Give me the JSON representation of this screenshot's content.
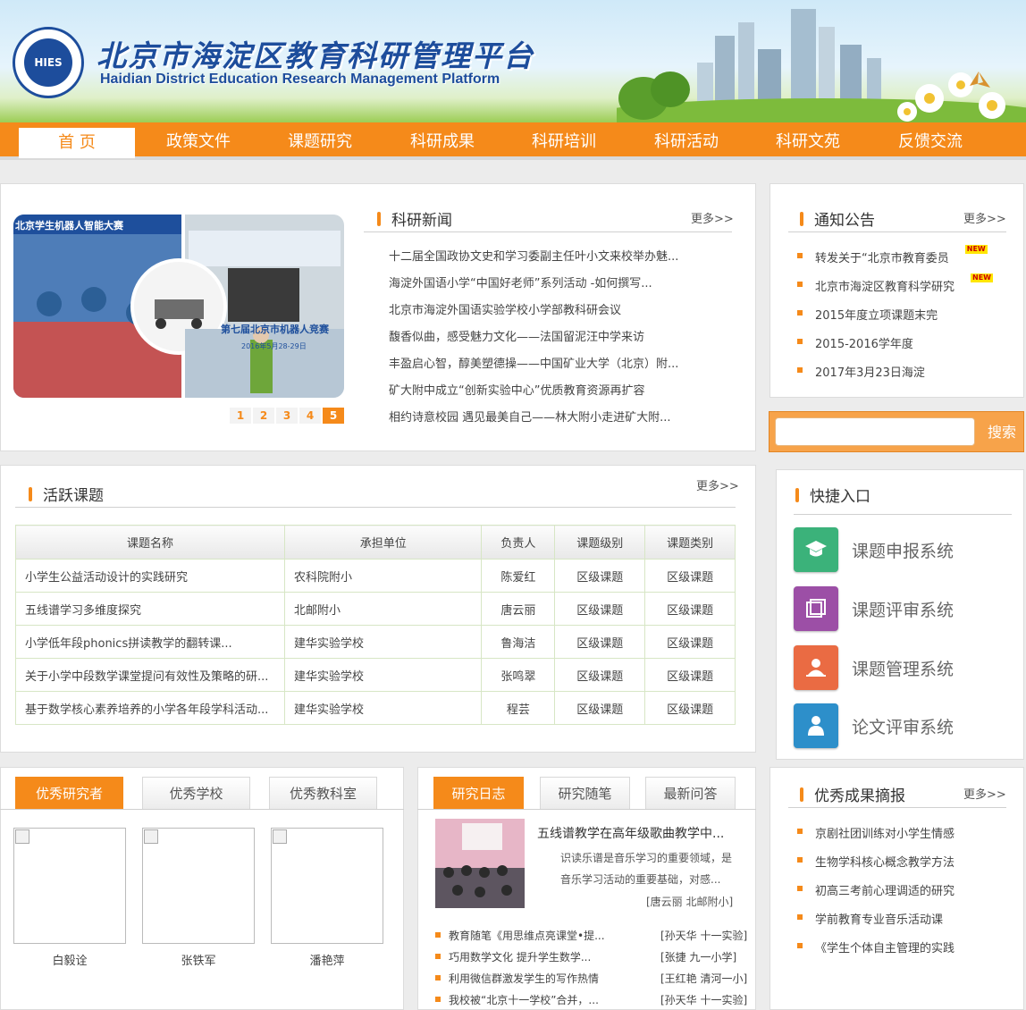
{
  "header": {
    "logo_text": "HIES",
    "title_cn": "北京市海淀区教育科研管理平台",
    "title_en": "Haidian District Education Research Management Platform"
  },
  "nav": {
    "items": [
      {
        "label": "首 页",
        "active": true
      },
      {
        "label": "政策文件"
      },
      {
        "label": "课题研究"
      },
      {
        "label": "科研成果"
      },
      {
        "label": "科研培训"
      },
      {
        "label": "科研活动"
      },
      {
        "label": "科研文苑"
      },
      {
        "label": "反馈交流"
      }
    ]
  },
  "colors": {
    "accent": "#f58a1a",
    "brand": "#1d4d9c"
  },
  "slideshow": {
    "caption_top": "北京学生机器人智能大赛",
    "caption_right": "第七届北京市机器人竞赛",
    "caption_date": "2016年5月28-29日",
    "pages": [
      "1",
      "2",
      "3",
      "4",
      "5"
    ],
    "current_page": 5
  },
  "news": {
    "title": "科研新闻",
    "more": "更多>>",
    "items": [
      "十二届全国政协文史和学习委副主任叶小文来校举办魅...",
      "海淀外国语小学“中国好老师”系列活动 -如何撰写...",
      "北京市海淀外国语实验学校小学部教科研会议",
      "馥香似曲，感受魅力文化——法国留泥汪中学来访",
      "丰盈启心智，醇美塑德操——中国矿业大学（北京）附...",
      "矿大附中成立“创新实验中心”优质教育资源再扩容",
      "相约诗意校园 遇见最美自己——林大附小走进矿大附..."
    ]
  },
  "notice": {
    "title": "通知公告",
    "more": "更多>>",
    "new_tag": "NEW",
    "items": [
      {
        "text": "转发关于“北京市教育委员",
        "is_new": true
      },
      {
        "text": "北京市海淀区教育科学研究",
        "is_new": true
      },
      {
        "text": "2015年度立项课题末完"
      },
      {
        "text": "2015-2016学年度"
      },
      {
        "text": "2017年3月23日海淀"
      }
    ]
  },
  "search": {
    "placeholder": "",
    "button": "搜索"
  },
  "projects": {
    "title": "活跃课题",
    "more": "更多>>",
    "columns": [
      "课题名称",
      "承担单位",
      "负责人",
      "课题级别",
      "课题类别"
    ],
    "rows": [
      [
        "小学生公益活动设计的实践研究",
        "农科院附小",
        "陈爱红",
        "区级课题",
        "区级课题"
      ],
      [
        "五线谱学习多维度探究",
        "北邮附小",
        "唐云丽",
        "区级课题",
        "区级课题"
      ],
      [
        "小学低年段phonics拼读教学的翻转课...",
        "建华实验学校",
        "鲁海洁",
        "区级课题",
        "区级课题"
      ],
      [
        "关于小学中段数学课堂提问有效性及策略的研...",
        "建华实验学校",
        "张鸣翠",
        "区级课题",
        "区级课题"
      ],
      [
        "基于数学核心素养培养的小学各年段学科活动...",
        "建华实验学校",
        "程芸",
        "区级课题",
        "区级课题"
      ]
    ]
  },
  "quick": {
    "title": "快捷入口",
    "items": [
      {
        "label": "课题申报系统",
        "icon": "graduation-cap-icon",
        "color": "#3bb27a"
      },
      {
        "label": "课题评审系统",
        "icon": "review-icon",
        "color": "#9c4fa6"
      },
      {
        "label": "课题管理系统",
        "icon": "manager-icon",
        "color": "#ea6b43"
      },
      {
        "label": "论文评审系统",
        "icon": "person-icon",
        "color": "#2d8fca"
      }
    ]
  },
  "people": {
    "tabs": [
      "优秀研究者",
      "优秀学校",
      "优秀教科室"
    ],
    "active_tab": 0,
    "items": [
      "白毅诠",
      "张铁军",
      "潘艳萍"
    ]
  },
  "diary": {
    "tabs": [
      "研究日志",
      "研究随笔",
      "最新问答"
    ],
    "active_tab": 0,
    "featured": {
      "title": "五线谱教学在高年级歌曲教学中...",
      "summary": "识读乐谱是音乐学习的重要领域，是音乐学习活动的重要基础，对感...",
      "author": "[唐云丽 北邮附小]"
    },
    "items": [
      {
        "text": "教育随笔《用思维点亮课堂•提...",
        "author": "[孙天华 十一实验]"
      },
      {
        "text": "巧用数学文化 提升学生数学...",
        "author": "[张捷 九一小学]"
      },
      {
        "text": "利用微信群激发学生的写作热情",
        "author": "[王红艳 清河一小]"
      },
      {
        "text": "我校被“北京十一学校”合并，...",
        "author": "[孙天华 十一实验]"
      }
    ]
  },
  "achievements": {
    "title": "优秀成果摘报",
    "more": "更多>>",
    "items": [
      "京剧社团训练对小学生情感",
      "生物学科核心概念教学方法",
      "初高三考前心理调适的研究",
      "学前教育专业音乐活动课",
      "《学生个体自主管理的实践"
    ]
  }
}
